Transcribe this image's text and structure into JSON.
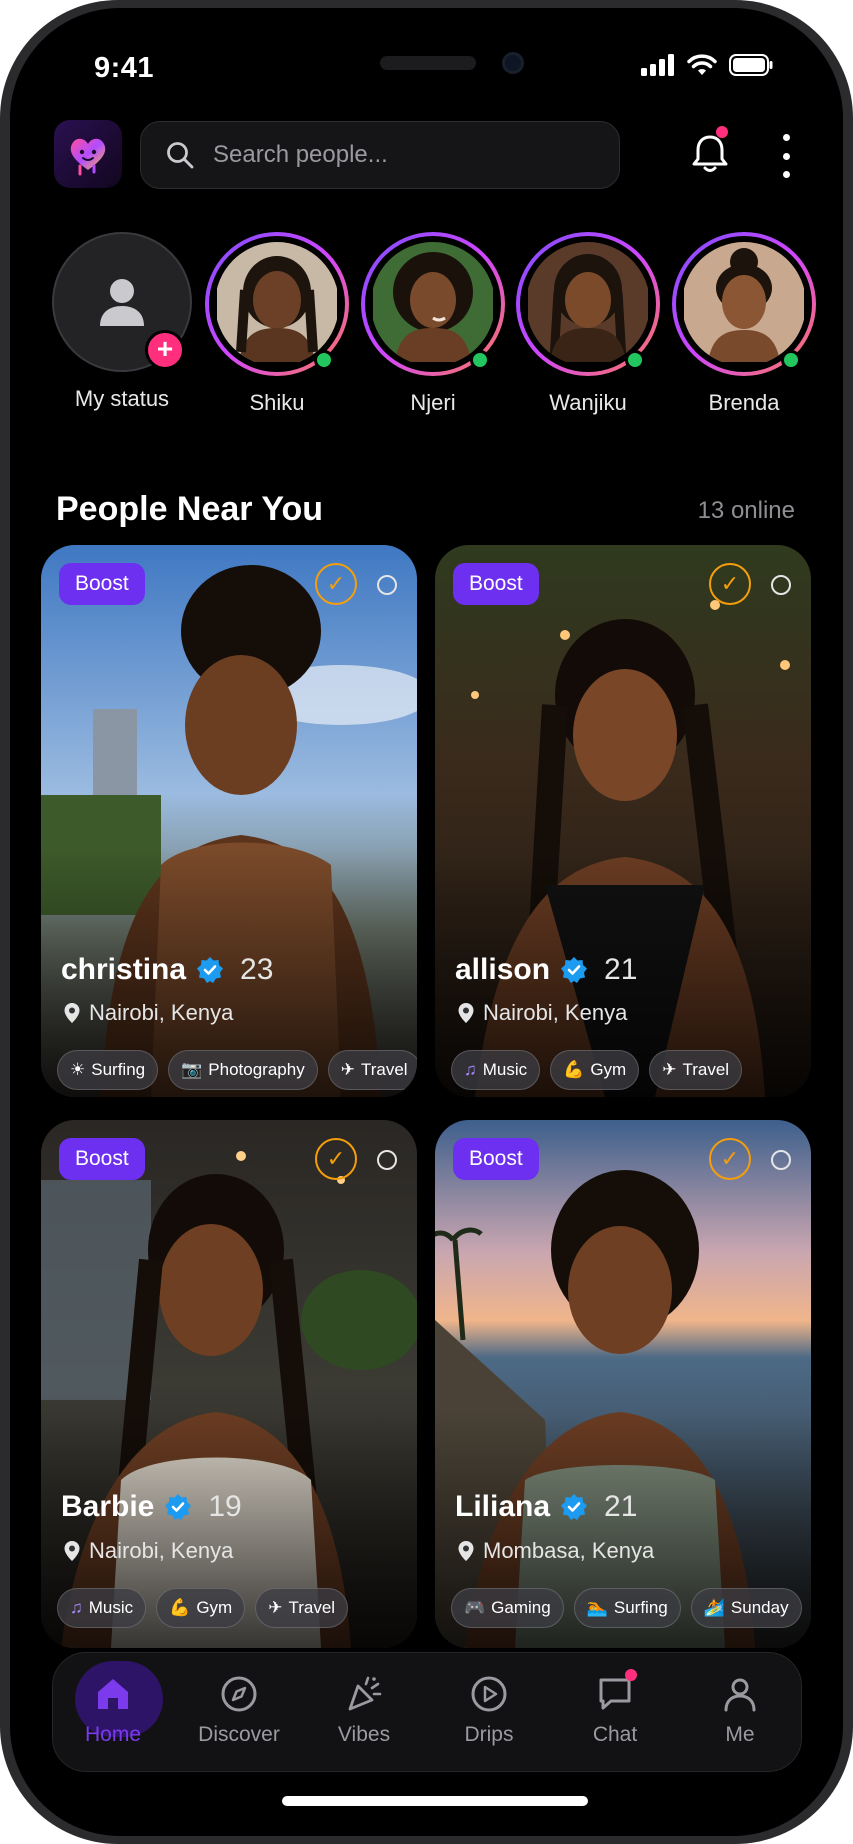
{
  "status_bar": {
    "time": "9:41"
  },
  "header": {
    "search_placeholder": "Search people...",
    "icons": [
      "app-logo",
      "search-icon",
      "bell-icon",
      "more-vertical-icon"
    ]
  },
  "stories": {
    "my_status_label": "My status",
    "items": [
      {
        "name": "Shiku"
      },
      {
        "name": "Njeri"
      },
      {
        "name": "Wanjiku"
      },
      {
        "name": "Brenda"
      }
    ]
  },
  "section": {
    "title": "People Near You",
    "online_count": "13 online"
  },
  "cards": [
    {
      "badge": "Boost",
      "name": "christina",
      "age": "23",
      "location": "Nairobi, Kenya",
      "tags": [
        {
          "icon": "☀",
          "label": "Surfing"
        },
        {
          "icon": "📷",
          "label": "Photography"
        },
        {
          "icon": "✈",
          "label": "Travel"
        }
      ]
    },
    {
      "badge": "Boost",
      "name": "allison",
      "age": "21",
      "location": "Nairobi, Kenya",
      "tags": [
        {
          "icon": "♫",
          "label": "Music"
        },
        {
          "icon": "💪",
          "label": "Gym"
        },
        {
          "icon": "✈",
          "label": "Travel"
        }
      ]
    },
    {
      "badge": "Boost",
      "name": "Barbie",
      "age": "19",
      "location": "Nairobi, Kenya",
      "tags": [
        {
          "icon": "♫",
          "label": "Music"
        },
        {
          "icon": "💪",
          "label": "Gym"
        },
        {
          "icon": "✈",
          "label": "Travel"
        }
      ]
    },
    {
      "badge": "Boost",
      "name": "Liliana",
      "age": "21",
      "location": "Mombasa, Kenya",
      "tags": [
        {
          "icon": "🎮",
          "label": "Gaming"
        },
        {
          "icon": "🏊",
          "label": "Surfing"
        },
        {
          "icon": "🏄",
          "label": "Sunday"
        }
      ]
    }
  ],
  "nav": {
    "items": [
      {
        "label": "Home",
        "active": true
      },
      {
        "label": "Discover"
      },
      {
        "label": "Vibes"
      },
      {
        "label": "Drips"
      },
      {
        "label": "Chat"
      },
      {
        "label": "Me"
      }
    ]
  },
  "colors": {
    "accent": "#6d2ff0",
    "active_nav": "#7c3aed",
    "notification": "#ff2f7d",
    "online": "#22c55e",
    "check": "#f59e0b",
    "verified": "#1d9bf0"
  }
}
